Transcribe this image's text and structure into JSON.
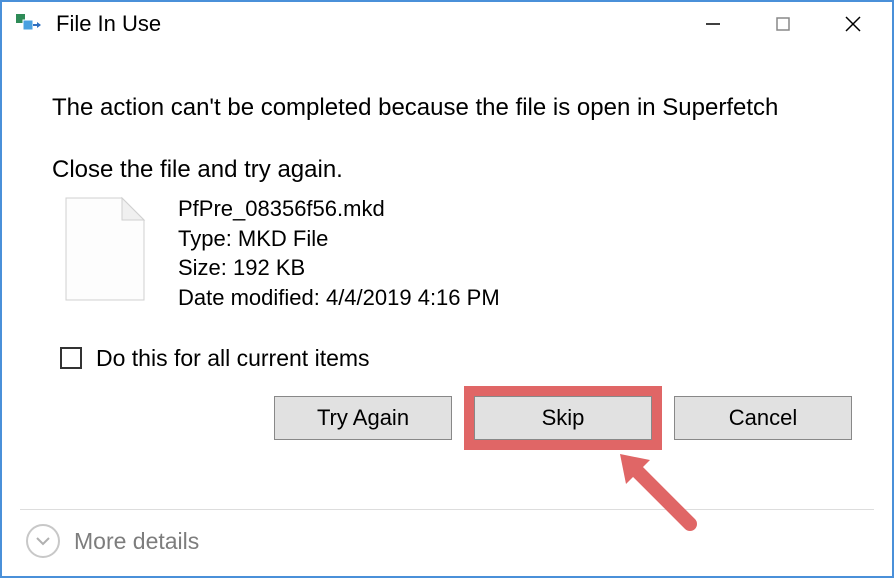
{
  "titlebar": {
    "title": "File In Use"
  },
  "headline": "The action can't be completed because the file is open in Superfetch",
  "instruction": "Close the file and try again.",
  "file": {
    "name": "PfPre_08356f56.mkd",
    "type_label": "Type: MKD File",
    "size_label": "Size: 192 KB",
    "modified_label": "Date modified: 4/4/2019 4:16 PM"
  },
  "checkbox_label": "Do this for all current items",
  "buttons": {
    "try_again": "Try Again",
    "skip": "Skip",
    "cancel": "Cancel"
  },
  "footer": {
    "more_details": "More details"
  }
}
